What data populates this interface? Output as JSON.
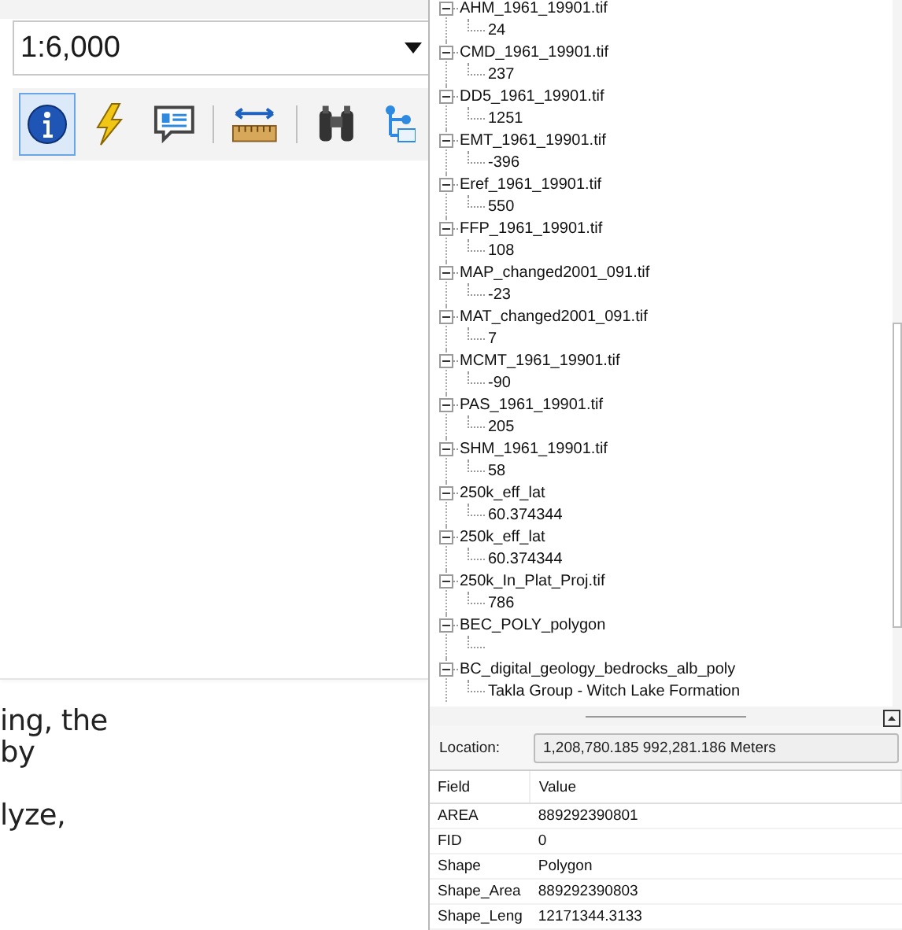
{
  "scale": {
    "value": "1:6,000"
  },
  "toolbar": [
    {
      "kind": "info",
      "selected": true
    },
    {
      "kind": "flash",
      "selected": false
    },
    {
      "kind": "popup",
      "selected": false
    },
    {
      "kind": "separator"
    },
    {
      "kind": "measure",
      "selected": false
    },
    {
      "kind": "separator"
    },
    {
      "kind": "find",
      "selected": false
    },
    {
      "kind": "route",
      "selected": false
    }
  ],
  "paragraph": "ing, the\nby\n\nlyze,",
  "tree": [
    {
      "label": "AHM_1961_19901.tif",
      "expanded": true,
      "value": "24"
    },
    {
      "label": "CMD_1961_19901.tif",
      "expanded": true,
      "value": "237"
    },
    {
      "label": "DD5_1961_19901.tif",
      "expanded": true,
      "value": "1251"
    },
    {
      "label": "EMT_1961_19901.tif",
      "expanded": true,
      "value": "-396"
    },
    {
      "label": "Eref_1961_19901.tif",
      "expanded": true,
      "value": "550"
    },
    {
      "label": "FFP_1961_19901.tif",
      "expanded": true,
      "value": "108"
    },
    {
      "label": "MAP_changed2001_091.tif",
      "expanded": true,
      "value": "-23"
    },
    {
      "label": "MAT_changed2001_091.tif",
      "expanded": true,
      "value": "7"
    },
    {
      "label": "MCMT_1961_19901.tif",
      "expanded": true,
      "value": "-90"
    },
    {
      "label": "PAS_1961_19901.tif",
      "expanded": true,
      "value": "205"
    },
    {
      "label": "SHM_1961_19901.tif",
      "expanded": true,
      "value": "58"
    },
    {
      "label": "250k_eff_lat",
      "expanded": true,
      "value": "60.374344"
    },
    {
      "label": "250k_eff_lat",
      "expanded": true,
      "value": "60.374344"
    },
    {
      "label": "250k_In_Plat_Proj.tif",
      "expanded": true,
      "value": "786"
    },
    {
      "label": "BEC_POLY_polygon",
      "expanded": true
    },
    {
      "label": "BC_digital_geology_bedrocks_alb_poly",
      "expanded": true,
      "value": "Takla Group - Witch Lake Formation"
    }
  ],
  "location": {
    "label": "Location:",
    "value": "1,208,780.185  992,281.186 Meters"
  },
  "table": {
    "columns": [
      "Field",
      "Value"
    ],
    "rows": [
      [
        "AREA",
        "889292390801"
      ],
      [
        "FID",
        "0"
      ],
      [
        "Shape",
        "Polygon"
      ],
      [
        "Shape_Area",
        "889292390803"
      ],
      [
        "Shape_Leng",
        "12171344.3133"
      ]
    ]
  }
}
